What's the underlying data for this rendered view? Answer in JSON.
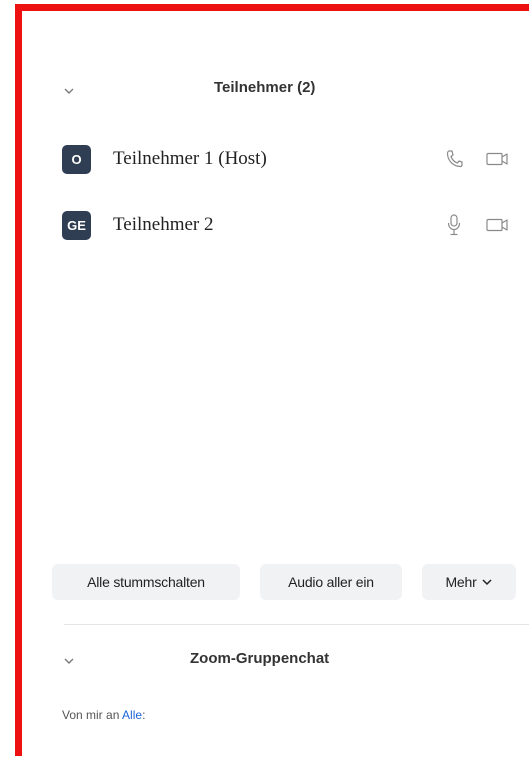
{
  "participants_panel": {
    "title": "Teilnehmer (2)",
    "participants": [
      {
        "initials": "O",
        "name": "Teilnehmer 1 (Host)",
        "audio_icon": "phone-icon",
        "video_icon": "video-off-icon"
      },
      {
        "initials": "GE",
        "name": "Teilnehmer 2",
        "audio_icon": "microphone-icon",
        "video_icon": "video-off-icon"
      }
    ],
    "buttons": {
      "mute_all": "Alle stummschalten",
      "unmute_all": "Audio aller ein",
      "more": "Mehr"
    }
  },
  "chat_panel": {
    "title": "Zoom-Gruppenchat",
    "to_prefix": "Von mir an",
    "to_recipient": "Alle",
    "to_suffix": ":"
  },
  "colors": {
    "frame_border": "#ee1111",
    "avatar_bg": "#2f3e52",
    "link": "#1a64d6",
    "button_bg": "#f1f2f4"
  }
}
